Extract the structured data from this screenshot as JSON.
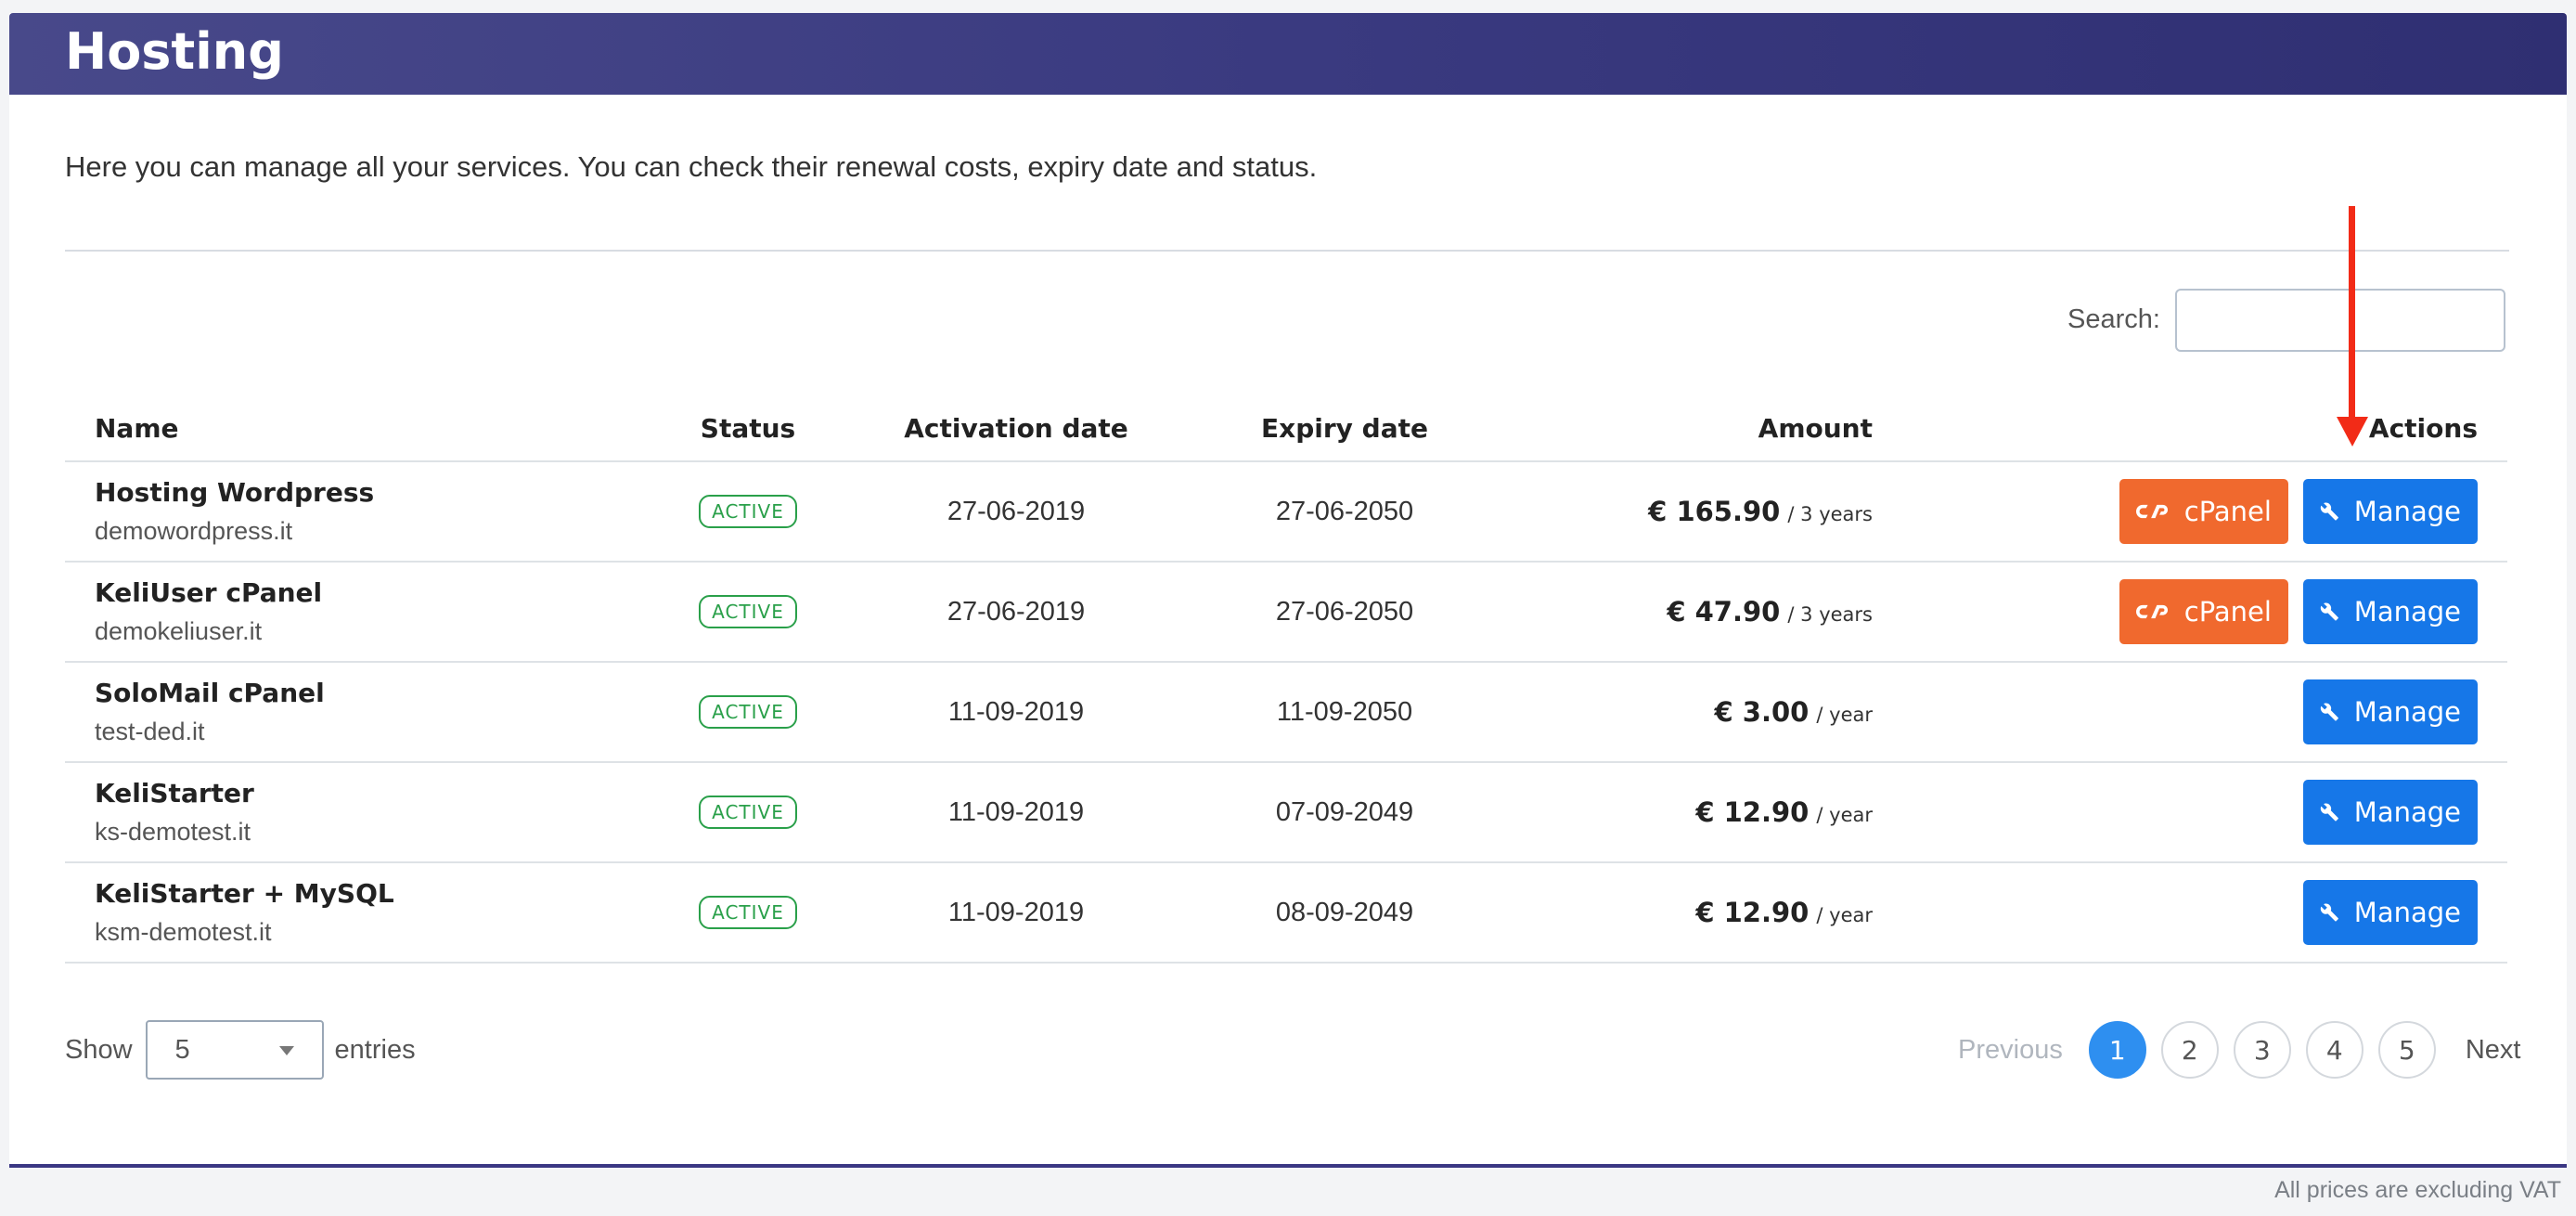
{
  "header": {
    "title": "Hosting"
  },
  "intro": "Here you can manage all your services. You can check their renewal costs, expiry date and status.",
  "search": {
    "label": "Search:",
    "value": "",
    "placeholder": ""
  },
  "table": {
    "columns": {
      "name": "Name",
      "status": "Status",
      "activation": "Activation date",
      "expiry": "Expiry date",
      "amount": "Amount",
      "actions": "Actions"
    },
    "rows": [
      {
        "name": "Hosting Wordpress",
        "domain": "demowordpress.it",
        "status": "ACTIVE",
        "activation": "27-06-2019",
        "expiry": "27-06-2050",
        "amount": "€ 165.90",
        "period": "/ 3 years",
        "cpanel_label": "cPanel",
        "manage_label": "Manage"
      },
      {
        "name": "KeliUser cPanel",
        "domain": "demokeliuser.it",
        "status": "ACTIVE",
        "activation": "27-06-2019",
        "expiry": "27-06-2050",
        "amount": "€ 47.90",
        "period": "/ 3 years",
        "cpanel_label": "cPanel",
        "manage_label": "Manage"
      },
      {
        "name": "SoloMail cPanel",
        "domain": "test-ded.it",
        "status": "ACTIVE",
        "activation": "11-09-2019",
        "expiry": "11-09-2050",
        "amount": "€ 3.00",
        "period": "/ year",
        "manage_label": "Manage"
      },
      {
        "name": "KeliStarter",
        "domain": "ks-demotest.it",
        "status": "ACTIVE",
        "activation": "11-09-2019",
        "expiry": "07-09-2049",
        "amount": "€ 12.90",
        "period": "/ year",
        "manage_label": "Manage"
      },
      {
        "name": "KeliStarter + MySQL",
        "domain": "ksm-demotest.it",
        "status": "ACTIVE",
        "activation": "11-09-2019",
        "expiry": "08-09-2049",
        "amount": "€ 12.90",
        "period": "/ year",
        "manage_label": "Manage"
      }
    ]
  },
  "length": {
    "show": "Show",
    "value": "5",
    "entries": "entries"
  },
  "pagination": {
    "previous": "Previous",
    "next": "Next",
    "pages": [
      "1",
      "2",
      "3",
      "4",
      "5"
    ],
    "current": "1"
  },
  "footer": {
    "note": "All prices are excluding VAT"
  },
  "colors": {
    "header": "#3a3a80",
    "cpanel": "#f0692e",
    "manage": "#1677e8",
    "active": "#2aa04a",
    "annotation_arrow": "#f22b17"
  },
  "icons": {
    "cpanel": "cpanel-logo-icon",
    "manage": "wrench-icon",
    "select": "chevron-down-icon",
    "annotation": "arrow-down-icon"
  }
}
